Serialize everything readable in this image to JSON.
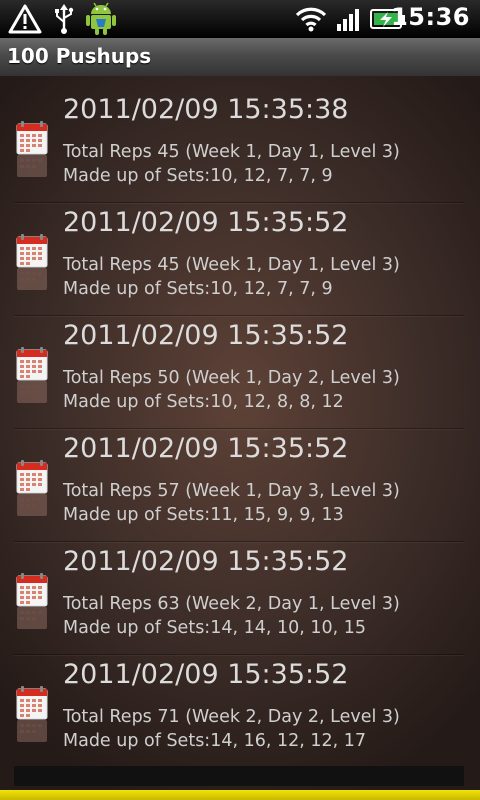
{
  "status_bar": {
    "clock": "15:36",
    "icons": [
      "warning-icon",
      "usb-icon",
      "android-debug-icon",
      "wifi-icon",
      "signal-icon",
      "battery-charging-icon"
    ]
  },
  "app": {
    "title": "100 Pushups"
  },
  "entries": [
    {
      "date": "2011/02/09 15:35:38",
      "total": "Total Reps 45 (Week 1, Day 1, Level 3)",
      "sets": "Made up of Sets:10, 12, 7, 7, 9"
    },
    {
      "date": "2011/02/09 15:35:52",
      "total": "Total Reps 45 (Week 1, Day 1, Level 3)",
      "sets": "Made up of Sets:10, 12, 7, 7, 9"
    },
    {
      "date": "2011/02/09 15:35:52",
      "total": "Total Reps 50 (Week 1, Day 2, Level 3)",
      "sets": "Made up of Sets:10, 12, 8, 8, 12"
    },
    {
      "date": "2011/02/09 15:35:52",
      "total": "Total Reps 57 (Week 1, Day 3, Level 3)",
      "sets": "Made up of Sets:11, 15, 9, 9, 13"
    },
    {
      "date": "2011/02/09 15:35:52",
      "total": "Total Reps 63 (Week 2, Day 1, Level 3)",
      "sets": "Made up of Sets:14, 14, 10, 10, 15"
    },
    {
      "date": "2011/02/09 15:35:52",
      "total": "Total Reps 71 (Week 2, Day 2, Level 3)",
      "sets": "Made up of Sets:14, 16, 12, 12, 17"
    }
  ],
  "colors": {
    "accent": "#e8d60a",
    "background": "#3d2d28",
    "calendar_red": "#d62b1f"
  }
}
